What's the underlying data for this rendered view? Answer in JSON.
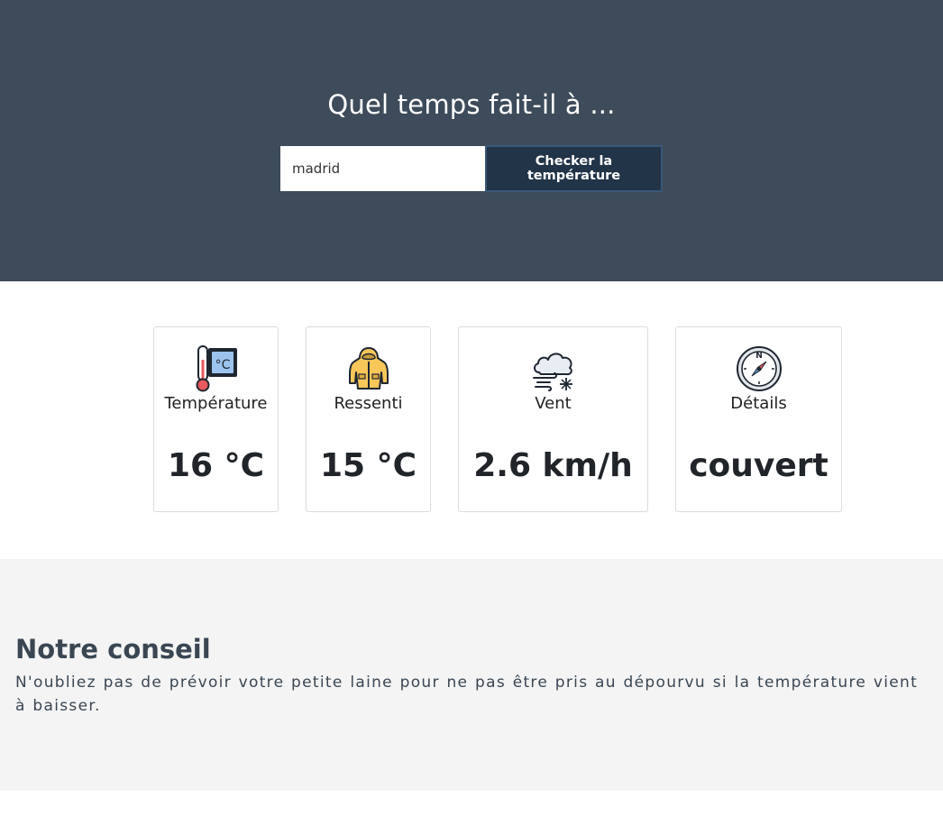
{
  "header": {
    "title": "Quel temps fait-il à ...",
    "search_value": "madrid",
    "button_label": "Checker la température"
  },
  "cards": [
    {
      "label": "Température",
      "value": "16 °C",
      "icon": "thermometer-icon"
    },
    {
      "label": "Ressenti",
      "value": "15 °C",
      "icon": "raincoat-icon"
    },
    {
      "label": "Vent",
      "value": "2.6 km/h",
      "icon": "wind-cloud-icon"
    },
    {
      "label": "Détails",
      "value": "couvert",
      "icon": "compass-icon"
    }
  ],
  "advice": {
    "title": "Notre conseil",
    "text": "N'oubliez pas de prévoir votre petite laine pour ne pas être pris au dépourvu si la température vient à baisser."
  },
  "colors": {
    "header_bg": "#3d4b5a",
    "button_bg": "#223447",
    "advice_bg": "#f4f4f4",
    "advice_text": "#3a4652"
  }
}
